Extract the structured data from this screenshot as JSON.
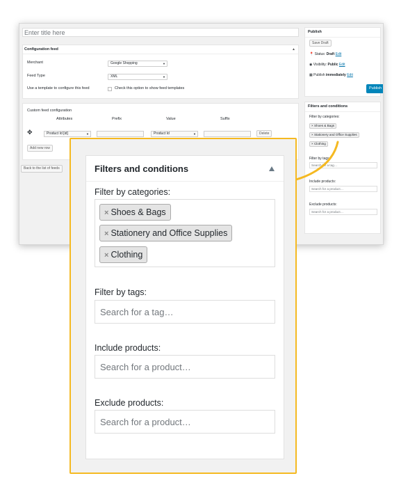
{
  "editor": {
    "title_placeholder": "Enter title here",
    "config": {
      "heading": "Configuration feed",
      "merchant_label": "Merchant",
      "merchant_value": "Google Shopping",
      "feed_type_label": "Feed Type",
      "feed_type_value": "XML",
      "template_label": "Use a template to configure this feed",
      "template_check_label": "Check this option to show feed templates"
    },
    "custom": {
      "heading": "Custom feed configuration",
      "columns": [
        "Attributes",
        "Prefix",
        "Value",
        "Suffix"
      ],
      "row": {
        "attribute": "Product Id [id]",
        "value": "Product Id"
      },
      "delete_label": "Delete",
      "add_row_label": "Add new row"
    },
    "back_label": "Back to the list of feeds"
  },
  "publish_box": {
    "heading": "Publish",
    "save_draft_label": "Save Draft",
    "status_label": "Status:",
    "status_value": "Draft",
    "visibility_label": "Visibility:",
    "visibility_value": "Public",
    "publish_label": "Publish",
    "publish_value": "immediately",
    "edit_label": "Edit",
    "publish_button_label": "Publish"
  },
  "filters": {
    "heading": "Filters and conditions",
    "categories_label": "Filter by categories:",
    "categories": [
      "Shoes & Bags",
      "Stationery and Office Supplies",
      "Clothing"
    ],
    "tags_label": "Filter by tags:",
    "tags_placeholder": "Search for a tag…",
    "include_label": "Include products:",
    "include_placeholder": "Search for a product…",
    "exclude_label": "Exclude products:",
    "exclude_placeholder": "Search for a product…"
  },
  "colors": {
    "highlight_border": "#f5b921",
    "link": "#0073aa",
    "publish_button": "#0085ba"
  }
}
